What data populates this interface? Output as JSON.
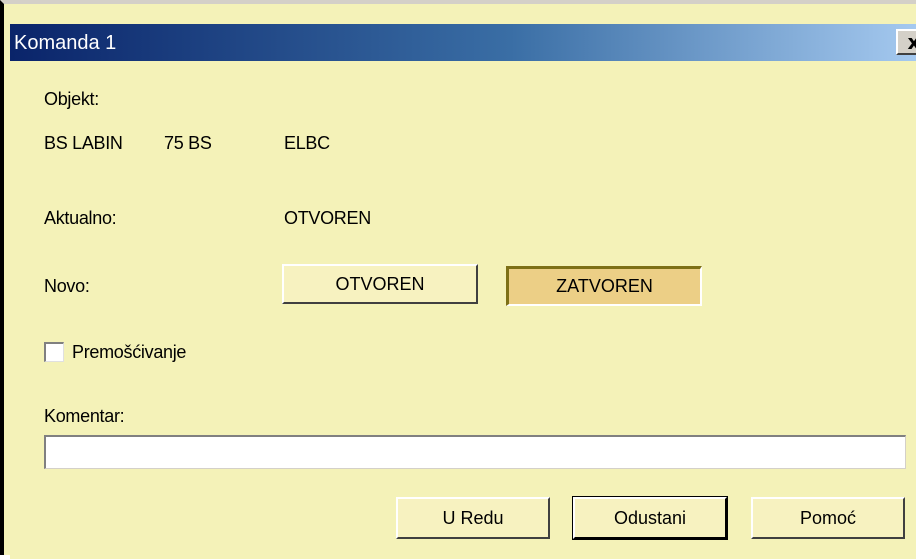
{
  "window": {
    "title": "Komanda 1",
    "close_glyph": "x"
  },
  "object": {
    "label": "Objekt:",
    "station": "BS LABIN",
    "bay": "75 BS",
    "element": "ELBC"
  },
  "current": {
    "label": "Aktualno:",
    "value": "OTVOREN"
  },
  "new": {
    "label": "Novo:",
    "options": [
      {
        "label": "OTVOREN",
        "selected": false
      },
      {
        "label": "ZATVOREN",
        "selected": true
      }
    ]
  },
  "bypass": {
    "label": "Premošćivanje",
    "checked": false
  },
  "comment": {
    "label": "Komentar:",
    "value": ""
  },
  "buttons": {
    "ok": "U Redu",
    "cancel": "Odustani",
    "help": "Pomoć"
  },
  "colors": {
    "dialog_background": "#f4f2b8",
    "title_gradient_start": "#0a246a",
    "title_gradient_end": "#a6caf0",
    "selected_option": "#eccf86"
  }
}
